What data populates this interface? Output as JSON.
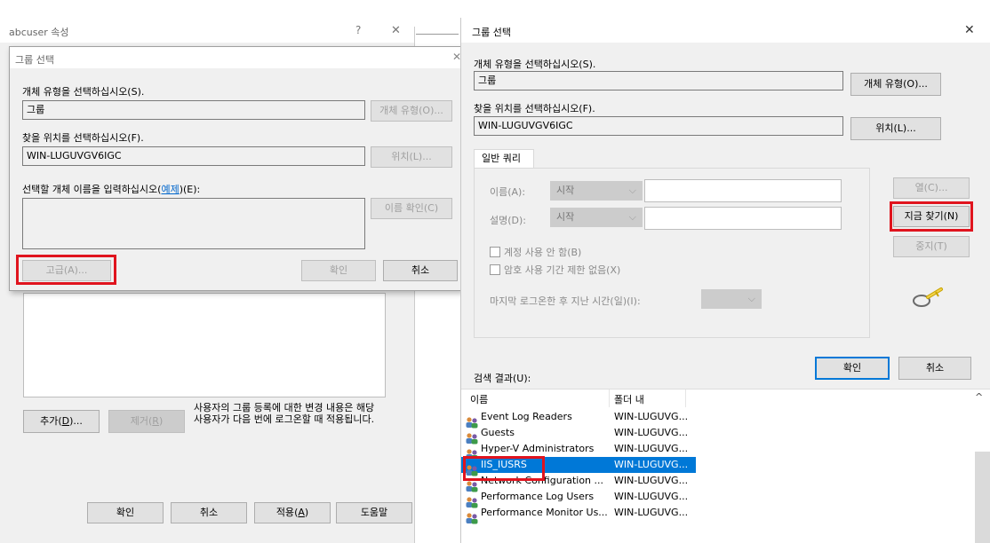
{
  "colors": {
    "accent": "#0078d7",
    "highlight": "#e0141e",
    "selection": "#0078d7"
  },
  "bg_window": {
    "title": "abcuser 속성",
    "help_glyph": "?",
    "close_glyph": "✕",
    "info_text": "사용자의 그룹 등록에 대한 변경 내용은 해당 사용자가 다음 번에 로그온할 때 적용됩니다.",
    "add_label": "추가",
    "add_key": "D",
    "remove_label": "제거",
    "remove_key": "R",
    "ok_label": "확인",
    "cancel_label": "취소",
    "apply_label": "적용",
    "apply_key": "A",
    "help_label": "도움말"
  },
  "small_dialog": {
    "title": "그룹 선택",
    "close_glyph": "✕",
    "object_type_label": "개체 유형을 선택하십시오(S).",
    "object_type_value": "그룹",
    "object_type_button": "개체 유형(O)...",
    "location_label": "찾을 위치를 선택하십시오(F).",
    "location_value": "WIN-LUGUVGV6IGC",
    "location_button": "위치(L)...",
    "enter_names_prefix": "선택할 개체 이름을 입력하십시오(",
    "enter_names_link": "예제",
    "enter_names_suffix": ")(E):",
    "check_names_button": "이름 확인(C)",
    "advanced_button": "고급(A)...",
    "ok_button": "확인",
    "cancel_button": "취소"
  },
  "adv_dialog": {
    "title": "그룹 선택",
    "close_glyph": "✕",
    "object_type_label": "개체 유형을 선택하십시오(S).",
    "object_type_value": "그룹",
    "object_type_button": "개체 유형(O)...",
    "location_label": "찾을 위치를 선택하십시오(F).",
    "location_value": "WIN-LUGUVGV6IGC",
    "location_button": "위치(L)...",
    "tab_label": "일반 쿼리",
    "name_label": "이름(A):",
    "name_combo": "시작",
    "desc_label": "설명(D):",
    "desc_combo": "시작",
    "chev": "⌵",
    "columns_button": "열(C)...",
    "find_now_button": "지금 찾기(N)",
    "stop_button": "중지(T)",
    "disabled_accounts_label": "계정 사용 안 함(B)",
    "non_expiring_label": "암호 사용 기간 제한 없음(X)",
    "last_logon_label": "마지막 로그온한 후 지난 시간(일)(I):",
    "ok_button": "확인",
    "cancel_button": "취소",
    "results_label": "검색 결과(U):",
    "col_name": "이름",
    "col_folder": "폴더 내",
    "scroll_up": "^",
    "rows": [
      {
        "name": "Event Log Readers",
        "folder": "WIN-LUGUVG..."
      },
      {
        "name": "Guests",
        "folder": "WIN-LUGUVG..."
      },
      {
        "name": "Hyper-V Administrators",
        "folder": "WIN-LUGUVG..."
      },
      {
        "name": "IIS_IUSRS",
        "folder": "WIN-LUGUVG..."
      },
      {
        "name": "Network Configuration ...",
        "folder": "WIN-LUGUVG..."
      },
      {
        "name": "Performance Log Users",
        "folder": "WIN-LUGUVG..."
      },
      {
        "name": "Performance Monitor Us...",
        "folder": "WIN-LUGUVG..."
      }
    ]
  }
}
